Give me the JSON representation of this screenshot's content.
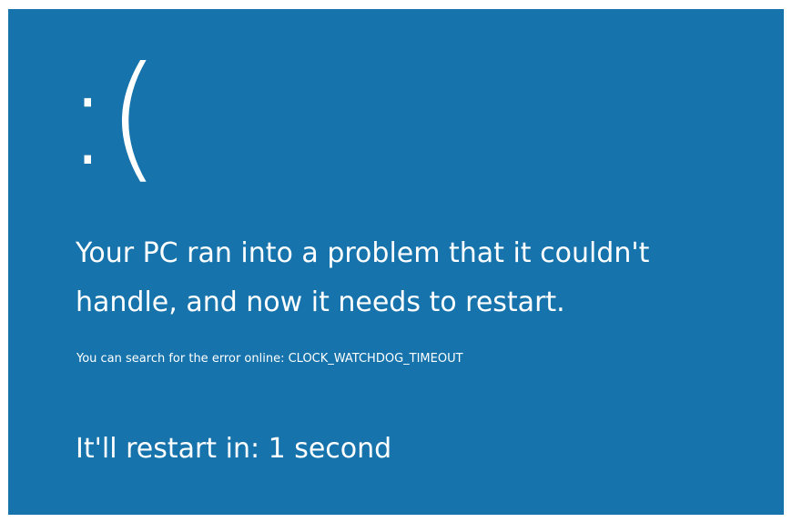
{
  "bsod": {
    "emoticon": ":(",
    "headline": "Your PC ran into a problem that it couldn't handle, and now it needs to restart.",
    "search_hint": "You can search for the error online: CLOCK_WATCHDOG_TIMEOUT",
    "countdown": "It'll restart in: 1 second"
  },
  "colors": {
    "background": "#1673ac",
    "text": "#ffffff"
  }
}
